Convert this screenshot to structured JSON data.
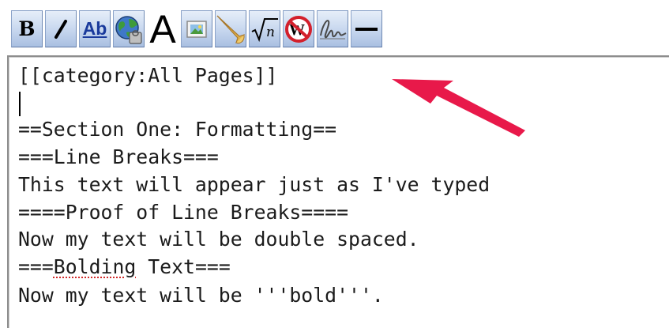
{
  "toolbar": {
    "bold_label": "B",
    "italic_label": "I",
    "link_label": "Ab",
    "headline_label": "A",
    "buttons": [
      {
        "name": "bold-button",
        "icon": "bold-icon"
      },
      {
        "name": "italic-button",
        "icon": "italic-icon"
      },
      {
        "name": "internal-link-button",
        "icon": "internal-link-icon"
      },
      {
        "name": "external-link-button",
        "icon": "globe-link-icon"
      },
      {
        "name": "headline-button",
        "icon": "headline-icon"
      },
      {
        "name": "embedded-image-button",
        "icon": "image-icon"
      },
      {
        "name": "media-link-button",
        "icon": "horn-icon"
      },
      {
        "name": "math-formula-button",
        "icon": "square-root-icon"
      },
      {
        "name": "no-wiki-button",
        "icon": "no-wiki-icon"
      },
      {
        "name": "signature-button",
        "icon": "signature-icon"
      },
      {
        "name": "horizontal-line-button",
        "icon": "horizontal-line-icon"
      }
    ]
  },
  "editor": {
    "lines": [
      "[[category:All Pages]]",
      "",
      "==Section One: Formatting==",
      "===Line Breaks===",
      "This text will appear just as I've typed",
      "====Proof of Line Breaks====",
      "Now my text will be double spaced.",
      "===",
      "Bolding",
      " Text===",
      "Now my text will be '''bold'''."
    ]
  },
  "annotation": {
    "arrow_color": "#e8194a",
    "toolbar_accent": "#1a3a9c"
  }
}
